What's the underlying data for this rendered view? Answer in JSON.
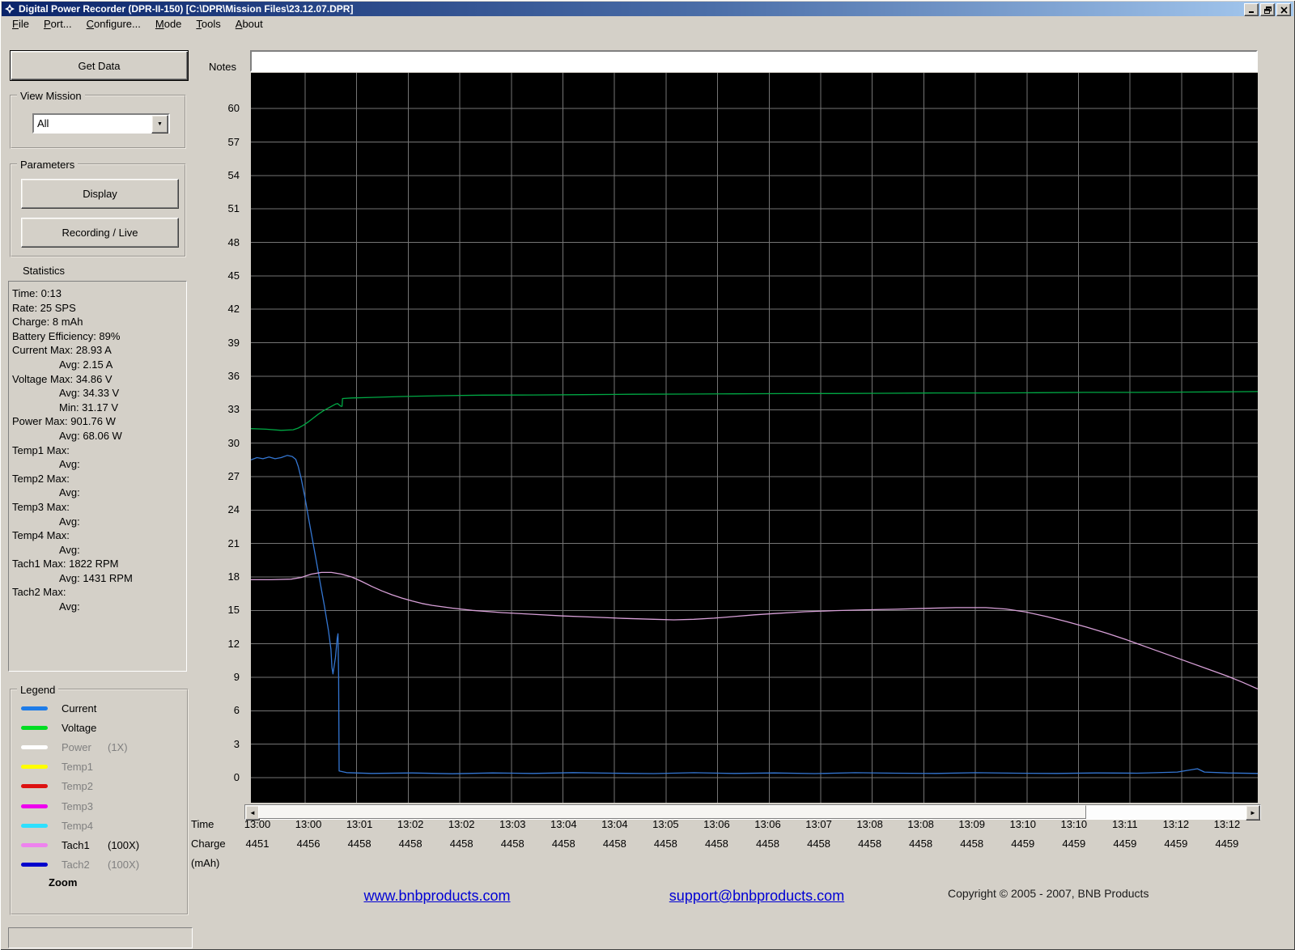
{
  "window": {
    "title": "Digital Power Recorder (DPR-II-150) [C:\\DPR\\Mission Files\\23.12.07.DPR]",
    "menu": [
      "File",
      "Port...",
      "Configure...",
      "Mode",
      "Tools",
      "About"
    ]
  },
  "sidebar": {
    "get_data_label": "Get Data",
    "view_mission": {
      "label": "View Mission",
      "value": "All"
    },
    "parameters": {
      "label": "Parameters",
      "display_label": "Display",
      "recording_label": "Recording / Live"
    },
    "statistics_label": "Statistics",
    "statistics_lines": [
      {
        "text": "Time: 0:13",
        "indent": 0
      },
      {
        "text": "Rate: 25 SPS",
        "indent": 0
      },
      {
        "text": "Charge: 8 mAh",
        "indent": 0
      },
      {
        "text": "Battery Efficiency: 89%",
        "indent": 0
      },
      {
        "text": "Current Max: 28.93 A",
        "indent": 0
      },
      {
        "text": "Avg: 2.15 A",
        "indent": 1
      },
      {
        "text": "Voltage Max: 34.86 V",
        "indent": 0
      },
      {
        "text": "Avg: 34.33 V",
        "indent": 1
      },
      {
        "text": "Min: 31.17 V",
        "indent": 1
      },
      {
        "text": "Power Max: 901.76 W",
        "indent": 0
      },
      {
        "text": "Avg: 68.06 W",
        "indent": 1
      },
      {
        "text": "Temp1 Max:",
        "indent": 0
      },
      {
        "text": "Avg:",
        "indent": 1
      },
      {
        "text": "Temp2 Max:",
        "indent": 0
      },
      {
        "text": "Avg:",
        "indent": 1
      },
      {
        "text": "Temp3 Max:",
        "indent": 0
      },
      {
        "text": "Avg:",
        "indent": 1
      },
      {
        "text": "Temp4 Max:",
        "indent": 0
      },
      {
        "text": "Avg:",
        "indent": 1
      },
      {
        "text": "Tach1 Max: 1822 RPM",
        "indent": 0
      },
      {
        "text": "Avg: 1431 RPM",
        "indent": 1
      },
      {
        "text": "Tach2 Max:",
        "indent": 0
      },
      {
        "text": "Avg:",
        "indent": 1
      }
    ],
    "legend": {
      "label": "Legend",
      "zoom_label": "Zoom",
      "items": [
        {
          "name": "Current",
          "suffix": "",
          "color": "#1e7ce8",
          "enabled": true
        },
        {
          "name": "Voltage",
          "suffix": "",
          "color": "#00dd22",
          "enabled": true
        },
        {
          "name": "Power",
          "suffix": "(1X)",
          "color": "#ffffff",
          "enabled": false
        },
        {
          "name": "Temp1",
          "suffix": "",
          "color": "#ffff00",
          "enabled": false
        },
        {
          "name": "Temp2",
          "suffix": "",
          "color": "#dd1111",
          "enabled": false
        },
        {
          "name": "Temp3",
          "suffix": "",
          "color": "#ee00ee",
          "enabled": false
        },
        {
          "name": "Temp4",
          "suffix": "",
          "color": "#2ee0ff",
          "enabled": false
        },
        {
          "name": "Tach1",
          "suffix": "(100X)",
          "color": "#ee82ee",
          "enabled": true
        },
        {
          "name": "Tach2",
          "suffix": "(100X)",
          "color": "#0000cc",
          "enabled": false
        }
      ]
    }
  },
  "chart": {
    "notes_label": "Notes",
    "notes_value": "",
    "time_label": "Time",
    "charge_label": "Charge",
    "mah_label": "(mAh)"
  },
  "chart_data": {
    "type": "line",
    "title": "",
    "xlabel": "Time",
    "ylabel": "",
    "ylim": [
      0,
      60
    ],
    "y_tick_step": 3,
    "grid": true,
    "background": "#000000",
    "gridline_color": "#757575",
    "x_categories_time": [
      "13:00",
      "13:00",
      "13:01",
      "13:02",
      "13:02",
      "13:03",
      "13:04",
      "13:04",
      "13:05",
      "13:06",
      "13:06",
      "13:07",
      "13:08",
      "13:08",
      "13:09",
      "13:10",
      "13:10",
      "13:11",
      "13:12",
      "13:12"
    ],
    "x_categories_charge": [
      "4451",
      "4456",
      "4458",
      "4458",
      "4458",
      "4458",
      "4458",
      "4458",
      "4458",
      "4458",
      "4458",
      "4458",
      "4458",
      "4458",
      "4458",
      "4459",
      "4459",
      "4459",
      "4459",
      "4459"
    ],
    "series": [
      {
        "name": "Current",
        "unit": "A",
        "color": "#3476d2",
        "points": [
          [
            0,
            28.5
          ],
          [
            0.006,
            28.7
          ],
          [
            0.012,
            28.6
          ],
          [
            0.018,
            28.75
          ],
          [
            0.024,
            28.6
          ],
          [
            0.03,
            28.7
          ],
          [
            0.036,
            28.9
          ],
          [
            0.041,
            28.8
          ],
          [
            0.0445,
            28.55
          ],
          [
            0.047,
            27.9
          ],
          [
            0.05,
            26.8
          ],
          [
            0.0535,
            25.2
          ],
          [
            0.057,
            23.4
          ],
          [
            0.061,
            21.4
          ],
          [
            0.065,
            19.4
          ],
          [
            0.069,
            17.4
          ],
          [
            0.073,
            15.4
          ],
          [
            0.077,
            13.2
          ],
          [
            0.0795,
            11.5
          ],
          [
            0.0805,
            9.9
          ],
          [
            0.0815,
            9.3
          ],
          [
            0.084,
            10.8
          ],
          [
            0.0857,
            12.5
          ],
          [
            0.0865,
            12.9
          ],
          [
            0.0871,
            9.0
          ],
          [
            0.0876,
            0.6
          ],
          [
            0.095,
            0.45
          ],
          [
            0.12,
            0.38
          ],
          [
            0.16,
            0.42
          ],
          [
            0.2,
            0.35
          ],
          [
            0.24,
            0.42
          ],
          [
            0.28,
            0.38
          ],
          [
            0.32,
            0.45
          ],
          [
            0.36,
            0.4
          ],
          [
            0.4,
            0.36
          ],
          [
            0.44,
            0.44
          ],
          [
            0.48,
            0.38
          ],
          [
            0.52,
            0.42
          ],
          [
            0.56,
            0.36
          ],
          [
            0.6,
            0.44
          ],
          [
            0.64,
            0.4
          ],
          [
            0.68,
            0.38
          ],
          [
            0.72,
            0.44
          ],
          [
            0.76,
            0.4
          ],
          [
            0.8,
            0.38
          ],
          [
            0.84,
            0.42
          ],
          [
            0.88,
            0.4
          ],
          [
            0.92,
            0.5
          ],
          [
            0.94,
            0.8
          ],
          [
            0.947,
            0.5
          ],
          [
            0.97,
            0.42
          ],
          [
            1,
            0.38
          ]
        ]
      },
      {
        "name": "Voltage",
        "unit": "V",
        "color": "#00a844",
        "points": [
          [
            0,
            31.3
          ],
          [
            0.015,
            31.25
          ],
          [
            0.03,
            31.15
          ],
          [
            0.042,
            31.2
          ],
          [
            0.047,
            31.35
          ],
          [
            0.052,
            31.6
          ],
          [
            0.057,
            31.9
          ],
          [
            0.062,
            32.25
          ],
          [
            0.067,
            32.6
          ],
          [
            0.072,
            32.9
          ],
          [
            0.077,
            33.15
          ],
          [
            0.081,
            33.35
          ],
          [
            0.084,
            33.5
          ],
          [
            0.086,
            33.55
          ],
          [
            0.0875,
            33.45
          ],
          [
            0.0895,
            33.3
          ],
          [
            0.0905,
            33.3
          ],
          [
            0.091,
            34.0
          ],
          [
            0.1,
            34.05
          ],
          [
            0.12,
            34.1
          ],
          [
            0.15,
            34.18
          ],
          [
            0.19,
            34.25
          ],
          [
            0.23,
            34.3
          ],
          [
            0.28,
            34.32
          ],
          [
            0.33,
            34.35
          ],
          [
            0.38,
            34.38
          ],
          [
            0.43,
            34.4
          ],
          [
            0.48,
            34.42
          ],
          [
            0.53,
            34.44
          ],
          [
            0.58,
            34.45
          ],
          [
            0.63,
            34.47
          ],
          [
            0.68,
            34.5
          ],
          [
            0.73,
            34.5
          ],
          [
            0.78,
            34.52
          ],
          [
            0.83,
            34.55
          ],
          [
            0.88,
            34.55
          ],
          [
            0.93,
            34.58
          ],
          [
            0.97,
            34.6
          ],
          [
            1,
            34.62
          ]
        ]
      },
      {
        "name": "Tach1 (100X)",
        "unit": "RPM/100",
        "color": "#d8a0d8",
        "points": [
          [
            0,
            17.75
          ],
          [
            0.02,
            17.75
          ],
          [
            0.04,
            17.8
          ],
          [
            0.05,
            17.95
          ],
          [
            0.06,
            18.25
          ],
          [
            0.07,
            18.4
          ],
          [
            0.08,
            18.4
          ],
          [
            0.09,
            18.25
          ],
          [
            0.1,
            18.0
          ],
          [
            0.11,
            17.6
          ],
          [
            0.12,
            17.15
          ],
          [
            0.13,
            16.75
          ],
          [
            0.14,
            16.4
          ],
          [
            0.15,
            16.1
          ],
          [
            0.16,
            15.85
          ],
          [
            0.17,
            15.62
          ],
          [
            0.18,
            15.45
          ],
          [
            0.2,
            15.2
          ],
          [
            0.22,
            15.0
          ],
          [
            0.25,
            14.8
          ],
          [
            0.28,
            14.65
          ],
          [
            0.31,
            14.5
          ],
          [
            0.34,
            14.4
          ],
          [
            0.37,
            14.28
          ],
          [
            0.4,
            14.2
          ],
          [
            0.42,
            14.15
          ],
          [
            0.44,
            14.2
          ],
          [
            0.46,
            14.3
          ],
          [
            0.48,
            14.45
          ],
          [
            0.5,
            14.6
          ],
          [
            0.52,
            14.72
          ],
          [
            0.55,
            14.88
          ],
          [
            0.58,
            14.98
          ],
          [
            0.61,
            15.05
          ],
          [
            0.64,
            15.1
          ],
          [
            0.67,
            15.18
          ],
          [
            0.7,
            15.25
          ],
          [
            0.73,
            15.25
          ],
          [
            0.75,
            15.12
          ],
          [
            0.77,
            14.85
          ],
          [
            0.79,
            14.45
          ],
          [
            0.81,
            14.0
          ],
          [
            0.83,
            13.5
          ],
          [
            0.85,
            12.95
          ],
          [
            0.87,
            12.35
          ],
          [
            0.89,
            11.7
          ],
          [
            0.91,
            11.05
          ],
          [
            0.93,
            10.4
          ],
          [
            0.95,
            9.75
          ],
          [
            0.97,
            9.1
          ],
          [
            0.985,
            8.55
          ],
          [
            1,
            7.95
          ]
        ]
      }
    ]
  },
  "footer": {
    "link1": "www.bnbproducts.com",
    "link2": "support@bnbproducts.com",
    "copyright": "Copyright © 2005 - 2007, BNB Products"
  }
}
